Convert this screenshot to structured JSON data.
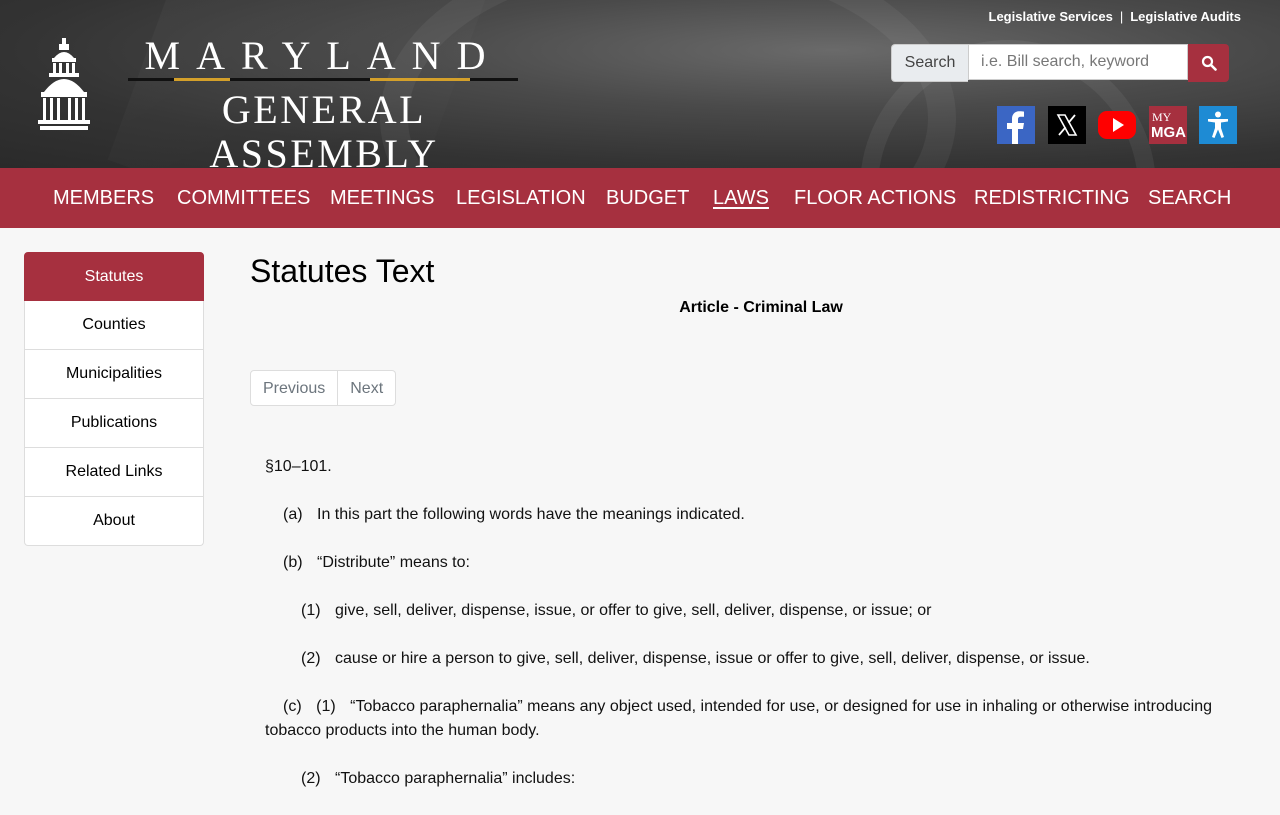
{
  "header": {
    "top_links": [
      "Legislative Services",
      "Legislative Audits"
    ],
    "top_sep": "|",
    "brand_top": "MARYLAND",
    "brand_bottom": "GENERAL ASSEMBLY",
    "search": {
      "label": "Search",
      "placeholder": "i.e. Bill search, keyword"
    },
    "social": [
      {
        "name": "facebook",
        "color": "#3b66c4"
      },
      {
        "name": "x-twitter",
        "color": "#000000"
      },
      {
        "name": "youtube",
        "color": "#ff0000"
      },
      {
        "name": "my-mga",
        "label_top": "MY",
        "label_bottom": "MGA",
        "color": "#a6303f"
      },
      {
        "name": "accessibility",
        "color": "#1e8bd4"
      }
    ]
  },
  "nav": {
    "items": [
      "MEMBERS",
      "COMMITTEES",
      "MEETINGS",
      "LEGISLATION",
      "BUDGET",
      "LAWS",
      "FLOOR ACTIONS",
      "REDISTRICTING",
      "SEARCH"
    ],
    "active": "LAWS"
  },
  "sidebar": {
    "items": [
      "Statutes",
      "Counties",
      "Municipalities",
      "Publications",
      "Related Links",
      "About"
    ],
    "active": "Statutes"
  },
  "main": {
    "title": "Statutes Text",
    "article": "Article - Criminal Law",
    "pager": {
      "previous": "Previous",
      "next": "Next"
    },
    "section": "§10–101.",
    "paragraphs": [
      {
        "marker": "(a)",
        "text": "In this part the following words have the meanings indicated."
      },
      {
        "marker": "(b)",
        "text": "“Distribute” means to:"
      },
      {
        "marker": "(1)",
        "text": "give, sell, deliver, dispense, issue, or offer to give, sell, deliver, dispense, or issue; or"
      },
      {
        "marker": "(2)",
        "text": "cause or hire a person to give, sell, deliver, dispense, issue or offer to give, sell, deliver, dispense, or issue."
      },
      {
        "marker": "(c)",
        "marker2": "(1)",
        "text": "“Tobacco paraphernalia” means any object used, intended for use, or designed for use in inhaling or otherwise introducing tobacco products into the human body."
      },
      {
        "marker": "(2)",
        "text": "“Tobacco paraphernalia” includes:"
      }
    ]
  },
  "colors": {
    "brand_red": "#a6303f",
    "gold": "#d4a02a",
    "background": "#f7f7f7"
  }
}
